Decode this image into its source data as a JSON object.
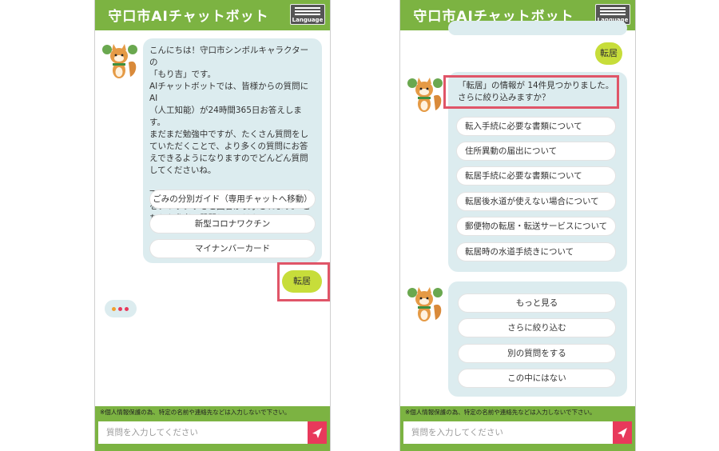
{
  "header": {
    "title": "守口市AIチャットボット",
    "language_label": "Language"
  },
  "footer": {
    "notice": "※個人情報保護の為、特定の名前や連絡先などは入力しないで下さい。",
    "input_placeholder": "質問を入力してください"
  },
  "left_screen": {
    "greeting": "こんにちは！守口市シンボルキャラクターの\n「もり吉」です。\nAIチャットボットでは、皆様からの質問にAI\n（人工知能）が24時間365日お答えします。\nまだまだ勉強中ですが、たくさん質問をしていただくことで、より多くの質問にお答えできるようになりますのでどんどん質問してくださいね。\n\n下記の内容がよく質問されています。 質問をクリックすると回答が表示されます。 こちらを参考に質問してください。",
    "quick_options": [
      "ごみの分別ガイド（専用チャットへ移動）",
      "新型コロナワクチン",
      "マイナンバーカード"
    ],
    "user_message": "転居"
  },
  "right_screen": {
    "user_message": "転居",
    "bot_reply": "「転居」の情報が 14件見つかりました。\nさらに絞り込みますか？",
    "results": [
      "転入手続に必要な書類について",
      "住所異動の届出について",
      "転居手続に必要な書類について",
      "転居後水道が使えない場合について",
      "郵便物の転居・転送サービスについて",
      "転居時の水道手続きについて"
    ],
    "actions": [
      "もっと見る",
      "さらに絞り込む",
      "別の質問をする",
      "この中にはない"
    ]
  },
  "colors": {
    "header_green": "#7cb342",
    "bot_bubble": "#dcecef",
    "user_bubble": "#c7dd3a",
    "send_button": "#e8395b",
    "highlight": "#e05568"
  },
  "icons": {
    "mascot": "squirrel-mascot-icon",
    "menu": "hamburger-menu-icon",
    "send": "paper-plane-icon",
    "typing": "typing-dots-icon"
  }
}
